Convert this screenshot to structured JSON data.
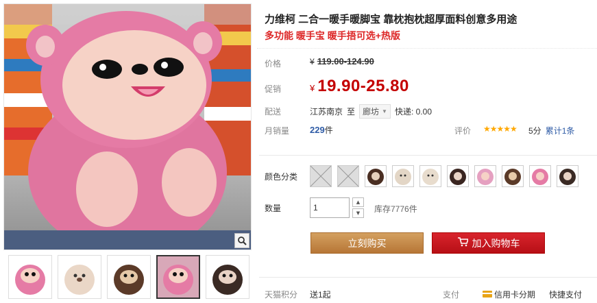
{
  "product": {
    "title": "力维柯 二合一暖手暖脚宝 靠枕抱枕超厚面料创意多用途",
    "subtitle": "多功能 暖手宝 暖手捂可选+热版"
  },
  "price": {
    "label": "价格",
    "currency": "¥",
    "original": "119.00-124.90",
    "promo_label": "促销",
    "promo": "19.90-25.80"
  },
  "shipping": {
    "label": "配送",
    "from": "江苏南京",
    "to_word": "至",
    "to_city": "廊坊",
    "fee": "快递: 0.00"
  },
  "sales": {
    "label": "月销量",
    "count": "229",
    "unit": "件",
    "review_label": "评价",
    "stars": "★★★★★",
    "score": "5分",
    "total_reviews": "累计1条"
  },
  "color": {
    "label": "颜色分类",
    "swatches": [
      "pink-monkey-dotted",
      "pink-monkey-dotted",
      "brown-bear",
      "cream-bear",
      "cream-bear",
      "dark-monkey",
      "pink-pig",
      "brown-bear",
      "pink-monkey",
      "dark-monkey"
    ]
  },
  "quantity": {
    "label": "数量",
    "value": "1",
    "stock": "库存7776件"
  },
  "buttons": {
    "buy_now": "立刻购买",
    "add_to_cart": "加入购物车"
  },
  "bottom": {
    "points_label": "天猫积分",
    "points_value": "送1起",
    "pay_label": "支付",
    "credit": "信用卡分期",
    "quick_pay": "快捷支付"
  },
  "colors": {
    "accent_red": "#c40000",
    "buy_button": "#b77636",
    "cart_button": "#c5141b",
    "link_blue": "#2e5ba6"
  },
  "icons": {
    "zoom": "magnifier-icon",
    "cart": "cart-icon",
    "credit_card": "credit-card-icon"
  }
}
